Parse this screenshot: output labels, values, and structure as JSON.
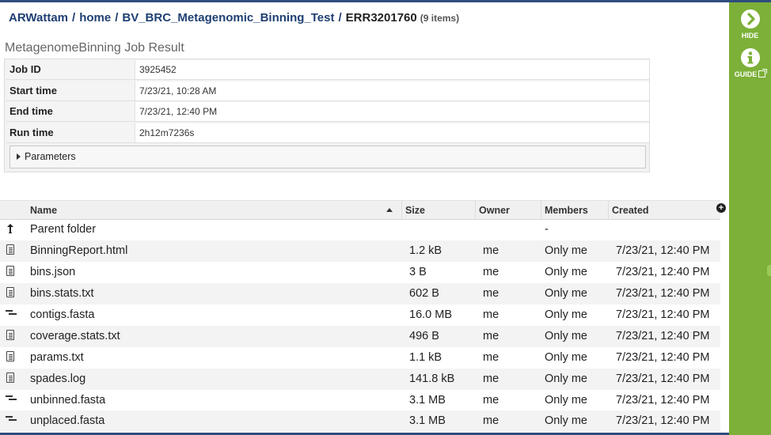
{
  "breadcrumb": {
    "items": [
      "ARWattam",
      "home",
      "BV_BRC_Metagenomic_Binning_Test",
      "ERR3201760"
    ],
    "count": "(9 items)"
  },
  "job": {
    "title": "MetagenomeBinning Job Result",
    "rows": [
      {
        "label": "Job ID",
        "value": "3925452"
      },
      {
        "label": "Start time",
        "value": "7/23/21, 10:28 AM"
      },
      {
        "label": "End time",
        "value": "7/23/21, 12:40 PM"
      },
      {
        "label": "Run time",
        "value": "2h12m7236s"
      }
    ],
    "parameters_label": "Parameters"
  },
  "grid": {
    "columns": {
      "name": "Name",
      "size": "Size",
      "owner": "Owner",
      "members": "Members",
      "created": "Created"
    },
    "add_column": "+",
    "parent": {
      "name": "Parent folder",
      "members": "-"
    },
    "rows": [
      {
        "icon": "file-icon",
        "name": "BinningReport.html",
        "size": "1.2 kB",
        "owner": "me",
        "members": "Only me",
        "created": "7/23/21, 12:40 PM"
      },
      {
        "icon": "file-icon",
        "name": "bins.json",
        "size": "3 B",
        "owner": "me",
        "members": "Only me",
        "created": "7/23/21, 12:40 PM"
      },
      {
        "icon": "file-icon",
        "name": "bins.stats.txt",
        "size": "602 B",
        "owner": "me",
        "members": "Only me",
        "created": "7/23/21, 12:40 PM"
      },
      {
        "icon": "sequence-icon",
        "name": "contigs.fasta",
        "size": "16.0 MB",
        "owner": "me",
        "members": "Only me",
        "created": "7/23/21, 12:40 PM"
      },
      {
        "icon": "file-icon",
        "name": "coverage.stats.txt",
        "size": "496 B",
        "owner": "me",
        "members": "Only me",
        "created": "7/23/21, 12:40 PM"
      },
      {
        "icon": "file-icon",
        "name": "params.txt",
        "size": "1.1 kB",
        "owner": "me",
        "members": "Only me",
        "created": "7/23/21, 12:40 PM"
      },
      {
        "icon": "file-icon",
        "name": "spades.log",
        "size": "141.8 kB",
        "owner": "me",
        "members": "Only me",
        "created": "7/23/21, 12:40 PM"
      },
      {
        "icon": "sequence-icon",
        "name": "unbinned.fasta",
        "size": "3.1 MB",
        "owner": "me",
        "members": "Only me",
        "created": "7/23/21, 12:40 PM"
      },
      {
        "icon": "sequence-icon",
        "name": "unplaced.fasta",
        "size": "3.1 MB",
        "owner": "me",
        "members": "Only me",
        "created": "7/23/21, 12:40 PM"
      }
    ]
  },
  "sidebar": {
    "hide_label": "HIDE",
    "guide_label": "GUIDE"
  },
  "colors": {
    "sidebar": "#7cb038",
    "accent": "#1f3f73",
    "row_alt": "#f3f3f3"
  }
}
